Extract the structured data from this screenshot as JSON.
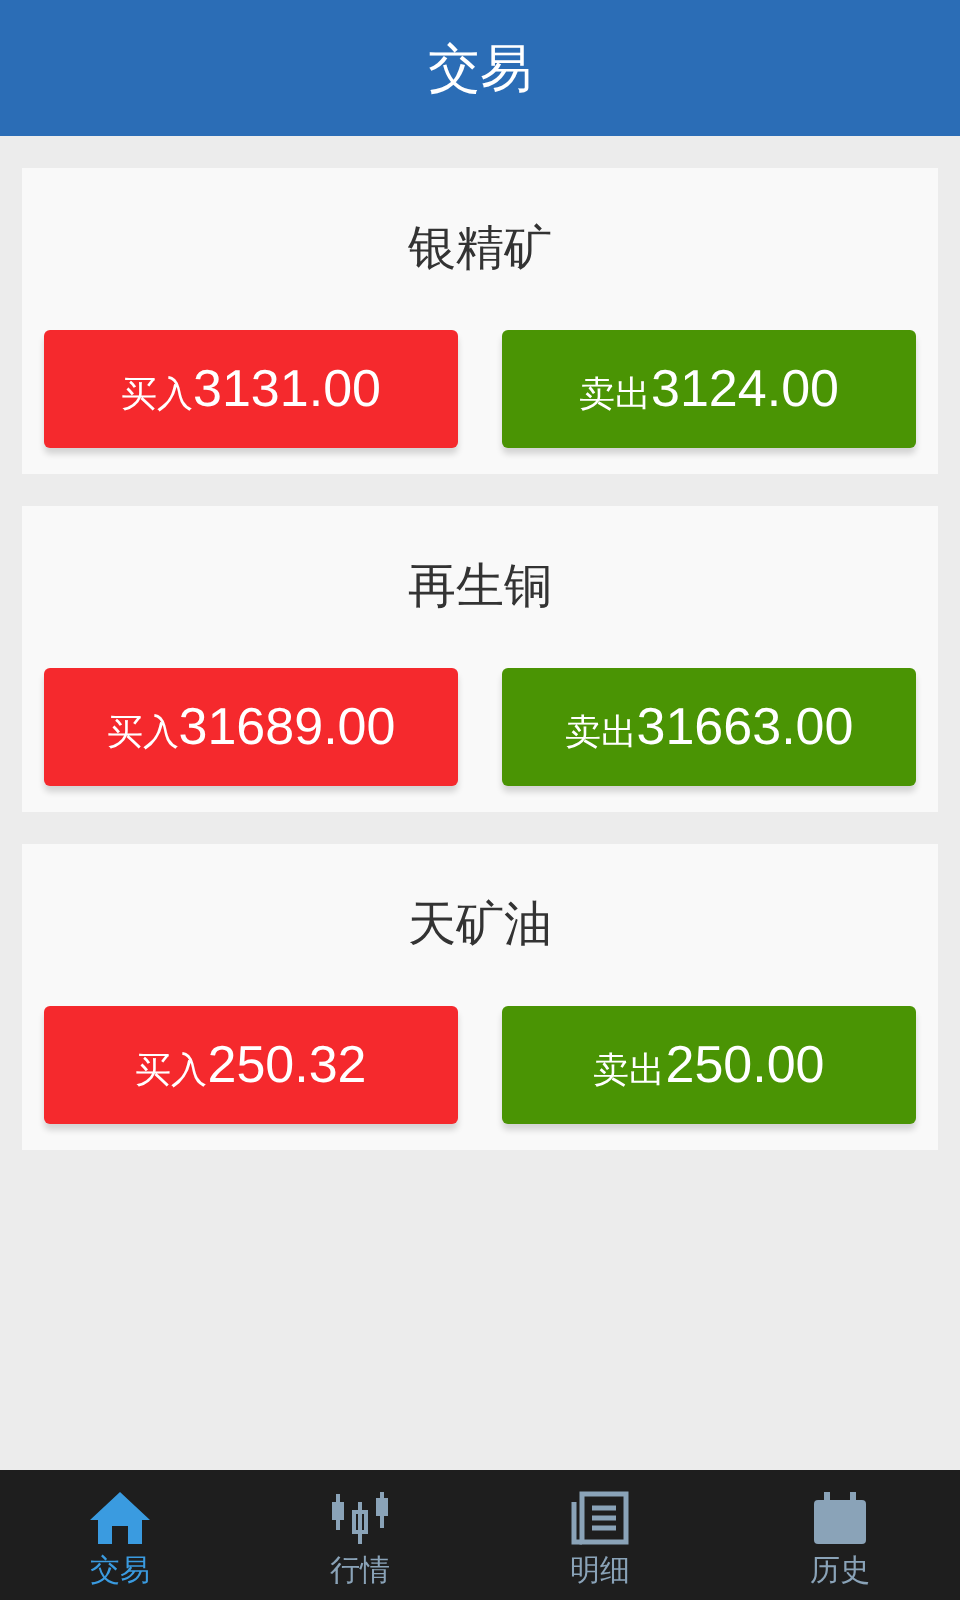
{
  "header": {
    "title": "交易"
  },
  "products": [
    {
      "name": "银精矿",
      "buy": {
        "label": "买入",
        "price": "3131.00"
      },
      "sell": {
        "label": "卖出",
        "price": "3124.00"
      }
    },
    {
      "name": "再生铜",
      "buy": {
        "label": "买入",
        "price": "31689.00"
      },
      "sell": {
        "label": "卖出",
        "price": "31663.00"
      }
    },
    {
      "name": "天矿油",
      "buy": {
        "label": "买入",
        "price": "250.32"
      },
      "sell": {
        "label": "卖出",
        "price": "250.00"
      }
    }
  ],
  "tabs": [
    {
      "label": "交易",
      "kind": "home",
      "selected": true
    },
    {
      "label": "行情",
      "kind": "candles",
      "selected": false
    },
    {
      "label": "明细",
      "kind": "list",
      "selected": false
    },
    {
      "label": "历史",
      "kind": "calendar",
      "selected": false
    }
  ]
}
